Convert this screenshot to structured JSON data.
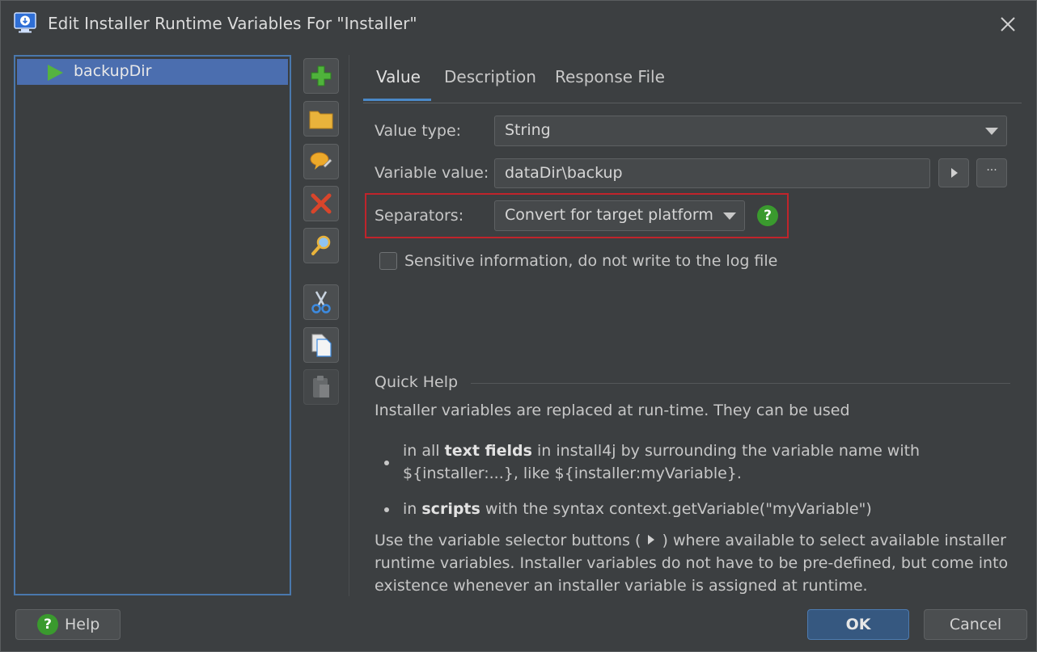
{
  "window": {
    "title": "Edit Installer Runtime Variables For \"Installer\""
  },
  "tree": {
    "items": [
      {
        "label": "backupDir"
      }
    ]
  },
  "tabs": [
    {
      "label": "Value"
    },
    {
      "label": "Description"
    },
    {
      "label": "Response File"
    }
  ],
  "form": {
    "value_type": {
      "label": "Value type:",
      "selected": "String"
    },
    "variable_value": {
      "label": "Variable value:",
      "value": "dataDir\\backup",
      "more_label": "···"
    },
    "separators": {
      "label": "Separators:",
      "selected": "Convert for target platform"
    },
    "sensitive": {
      "label": "Sensitive information, do not write to the log file",
      "checked": false
    }
  },
  "quick_help": {
    "title": "Quick Help",
    "intro": "Installer variables are replaced at run-time. They can be used",
    "bullet1": {
      "pre": "in all ",
      "bold": "text fields",
      "post": " in install4j by surrounding the variable name with",
      "line2": "${installer:...}, like ${installer:myVariable}."
    },
    "bullet2": {
      "pre": "in ",
      "bold": "scripts",
      "post": " with the syntax context.getVariable(\"myVariable\")"
    },
    "outro": {
      "line1_pre": "Use the variable selector buttons (",
      "line1_post": ") where available to select available installer",
      "line2": "runtime variables. Installer variables do not have to be pre-defined, but come into",
      "line3": "existence whenever an installer variable is assigned at runtime."
    }
  },
  "buttons": {
    "help": "Help",
    "ok": "OK",
    "cancel": "Cancel"
  },
  "colors": {
    "accent": "#4b6eaf",
    "highlight": "#c0242b",
    "help_green": "#3a9a2e"
  }
}
